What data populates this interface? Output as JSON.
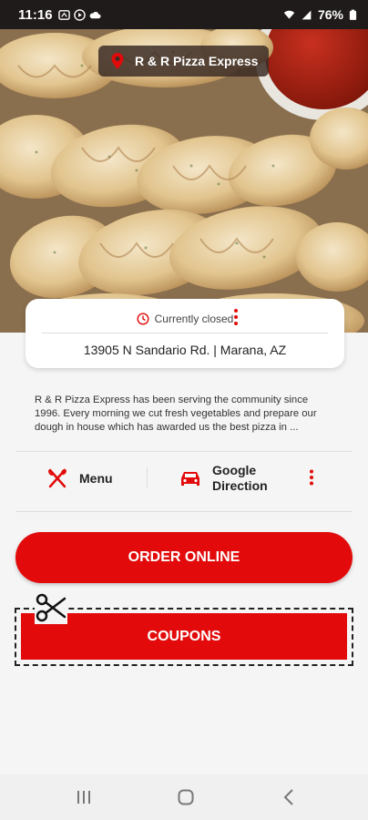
{
  "status_bar": {
    "time": "11:16",
    "battery": "76%"
  },
  "restaurant": {
    "name": "R & R Pizza Express",
    "status": "Currently closed",
    "address": "13905 N Sandario Rd.  | Marana, AZ",
    "description": "R & R Pizza Express has been serving the community since 1996. Every morning we cut fresh vegetables and prepare our dough in house which has awarded us the best pizza in ..."
  },
  "actions": {
    "menu_label": "Menu",
    "google_label": "Google Direction",
    "order_label": "ORDER ONLINE",
    "coupons_label": "COUPONS"
  },
  "icons": {
    "pin": "location-pin-icon",
    "clock": "clock-icon",
    "fork": "fork-knife-icon",
    "car": "car-icon",
    "more": "more-vertical-icon",
    "scissors": "scissors-icon"
  },
  "colors": {
    "accent": "#e20a0a",
    "status_bar": "#1f1b1a"
  }
}
